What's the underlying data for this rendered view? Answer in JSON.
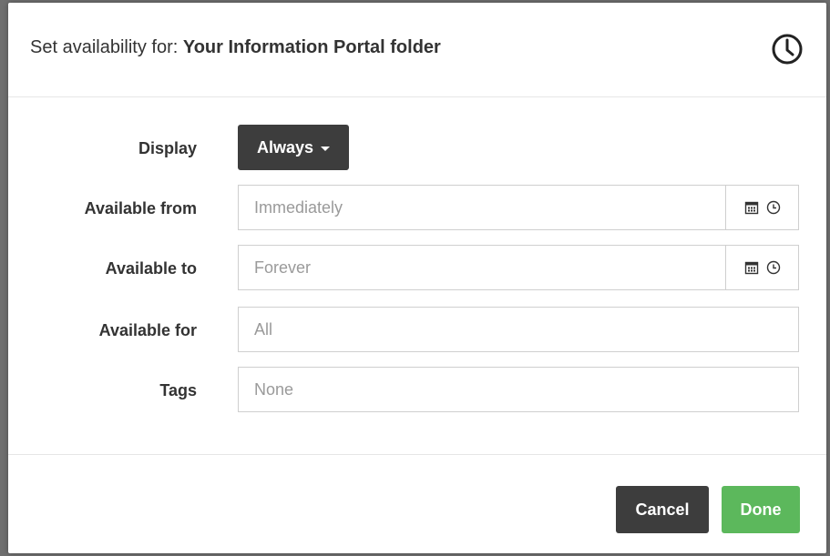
{
  "dialog": {
    "title_prefix": "Set availability for: ",
    "title_target": "Your Information Portal folder",
    "header_icon": "clock-icon"
  },
  "form": {
    "display": {
      "label": "Display",
      "value": "Always"
    },
    "available_from": {
      "label": "Available from",
      "placeholder": "Immediately",
      "icons": [
        "calendar-icon",
        "clock-icon"
      ]
    },
    "available_to": {
      "label": "Available to",
      "placeholder": "Forever",
      "icons": [
        "calendar-icon",
        "clock-icon"
      ]
    },
    "available_for": {
      "label": "Available for",
      "placeholder": "All"
    },
    "tags": {
      "label": "Tags",
      "placeholder": "None"
    }
  },
  "footer": {
    "cancel_label": "Cancel",
    "done_label": "Done"
  },
  "colors": {
    "dark_button": "#3d3d3d",
    "done_button": "#5cb85c",
    "placeholder_text": "#9a9a9a"
  }
}
